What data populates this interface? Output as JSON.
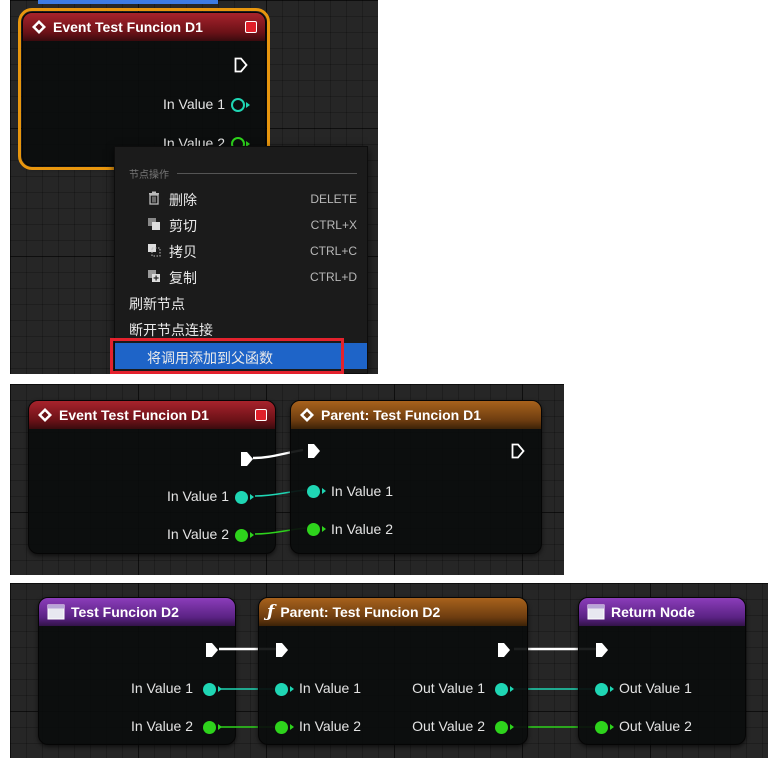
{
  "panel1": {
    "node": {
      "title": "Event Test Funcion D1",
      "pins": [
        "In Value 1",
        "In Value 2"
      ]
    },
    "menu": {
      "section": "节点操作",
      "items": [
        {
          "label": "删除",
          "shortcut": "DELETE",
          "icon": "trash-icon"
        },
        {
          "label": "剪切",
          "shortcut": "CTRL+X",
          "icon": "cut-icon"
        },
        {
          "label": "拷贝",
          "shortcut": "CTRL+C",
          "icon": "copy-icon"
        },
        {
          "label": "复制",
          "shortcut": "CTRL+D",
          "icon": "duplicate-icon"
        },
        {
          "label": "刷新节点",
          "shortcut": ""
        },
        {
          "label": "断开节点连接",
          "shortcut": ""
        },
        {
          "label": "将调用添加到父函数",
          "shortcut": "",
          "highlighted": true
        }
      ]
    }
  },
  "panel2": {
    "event_node": {
      "title": "Event Test Funcion D1",
      "pins": [
        "In Value 1",
        "In Value 2"
      ]
    },
    "parent_node": {
      "title": "Parent: Test Funcion D1",
      "pins": [
        "In Value 1",
        "In Value 2"
      ]
    }
  },
  "panel3": {
    "entry_node": {
      "title": "Test Funcion D2",
      "pins": [
        "In Value 1",
        "In Value 2"
      ]
    },
    "parent_node": {
      "title": "Parent: Test Funcion D2",
      "inputs": [
        "In Value 1",
        "In Value 2"
      ],
      "outputs": [
        "Out Value 1",
        "Out Value 2"
      ]
    },
    "return_node": {
      "title": "Return Node",
      "pins": [
        "Out Value 1",
        "Out Value 2"
      ]
    }
  },
  "colors": {
    "float_pin": "#1fd6b4",
    "int_pin": "#2ed31c",
    "selection": "#e8960e",
    "menu_highlight": "#1e64c8",
    "annotation_box": "#e3222d"
  }
}
